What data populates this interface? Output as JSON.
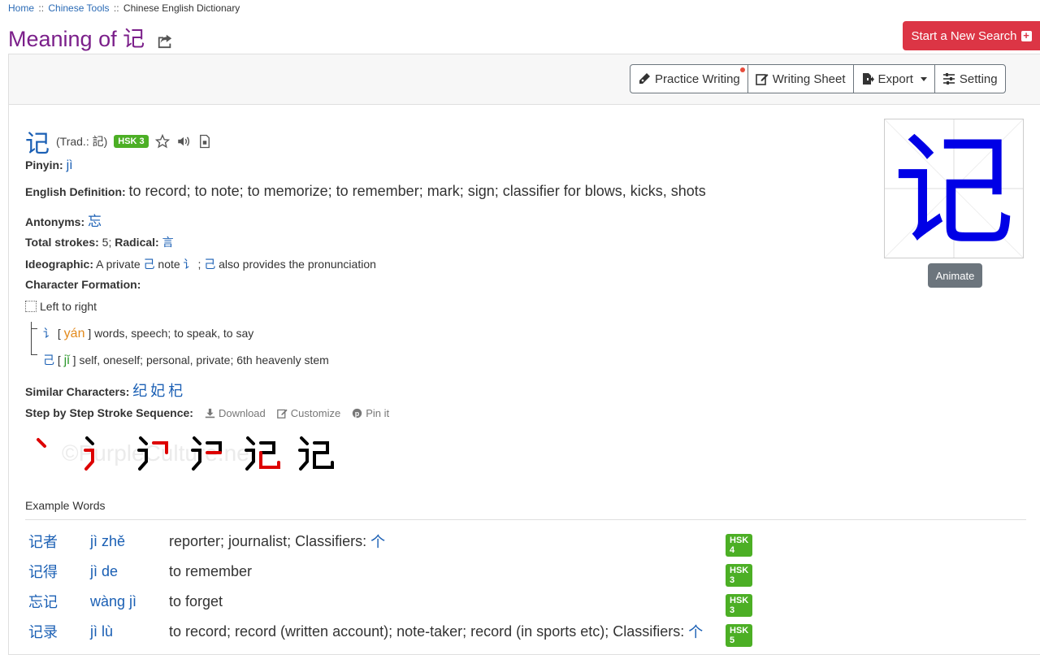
{
  "breadcrumb": {
    "home": "Home",
    "tools": "Chinese Tools",
    "current": "Chinese English Dictionary",
    "sep": "::"
  },
  "title": "Meaning of 记",
  "new_search_label": "Start a New Search",
  "toolbar": {
    "practice_writing": "Practice Writing",
    "writing_sheet": "Writing Sheet",
    "export": "Export",
    "setting": "Setting"
  },
  "entry": {
    "character": "记",
    "trad": "(Trad.: 記)",
    "hsk": "HSK 3",
    "pinyin_label": "Pinyin:",
    "pinyin": "jì",
    "definition_label": "English Definition:",
    "definition": "to record; to note; to memorize; to remember; mark; sign; classifier for blows, kicks, shots",
    "antonyms_label": "Antonyms:",
    "antonyms": "忘",
    "strokes_label": "Total strokes:",
    "strokes": "5",
    "radical_label": "Radical:",
    "radical": "言",
    "ideographic_label": "Ideographic:",
    "ideographic_1": "A private",
    "ideographic_c1": "己",
    "ideographic_2": "note",
    "ideographic_c2": "讠",
    "ideographic_sep": ";",
    "ideographic_c3": "己",
    "ideographic_3": "also provides the pronunciation",
    "formation_label": "Character Formation:",
    "formation_type": "Left to right",
    "components": [
      {
        "char": "讠",
        "pinyin": "yán",
        "meaning": "words, speech; to speak, to say"
      },
      {
        "char": "己",
        "pinyin": "jǐ",
        "meaning": "self, oneself; personal, private; 6th heavenly stem"
      }
    ],
    "similar_label": "Similar Characters:",
    "similar": [
      "纪",
      "妃",
      "杞"
    ],
    "stroke_label": "Step by Step Stroke Sequence:",
    "download": "Download",
    "customize": "Customize",
    "pin": "Pin it",
    "watermark": "©PurpleCulture.net",
    "animate": "Animate"
  },
  "examples_title": "Example Words",
  "examples": [
    {
      "word": "记者",
      "pinyin": "jì zhě",
      "def": "reporter; journalist; Classifiers:",
      "classifier": "个",
      "hsk": "HSK 4"
    },
    {
      "word": "记得",
      "pinyin": "jì de",
      "def": "to remember",
      "classifier": "",
      "hsk": "HSK 3"
    },
    {
      "word": "忘记",
      "pinyin": "wàng jì",
      "def": "to forget",
      "classifier": "",
      "hsk": "HSK 3"
    },
    {
      "word": "记录",
      "pinyin": "jì lù",
      "def": "to record; record (written account); note-taker; record (in sports etc); Classifiers:",
      "classifier": "个",
      "hsk": "HSK 5"
    }
  ],
  "colors": {
    "title": "#7b1f8a",
    "link": "#1a5fb4",
    "hsk": "#4caf25",
    "danger": "#dc3545"
  }
}
